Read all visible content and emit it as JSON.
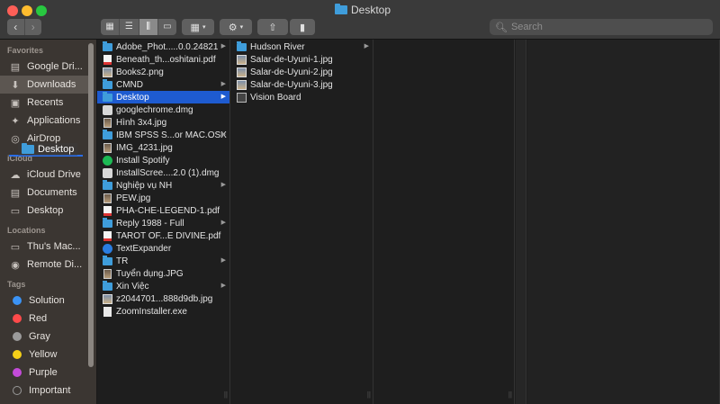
{
  "window": {
    "title": "Desktop"
  },
  "toolbar": {
    "back_icon": "chevron-left-icon",
    "forward_icon": "chevron-right-icon",
    "view_modes": [
      "icon-view",
      "list-view",
      "column-view",
      "gallery-view"
    ],
    "active_view": "column-view",
    "search_placeholder": "Search"
  },
  "sidebar": {
    "sections": [
      {
        "title": "Favorites",
        "items": [
          {
            "label": "Google Dri...",
            "icon": "folder-icon"
          },
          {
            "label": "Downloads",
            "icon": "download-icon",
            "selected": true
          },
          {
            "label": "Recents",
            "icon": "clock-icon"
          },
          {
            "label": "Applications",
            "icon": "applications-icon"
          },
          {
            "label": "AirDrop",
            "icon": "airdrop-icon"
          }
        ]
      },
      {
        "title": "iCloud",
        "items": [
          {
            "label": "iCloud Drive",
            "icon": "cloud-icon"
          },
          {
            "label": "Documents",
            "icon": "document-icon"
          },
          {
            "label": "Desktop",
            "icon": "desktop-icon"
          }
        ]
      },
      {
        "title": "Locations",
        "items": [
          {
            "label": "Thu's Mac...",
            "icon": "laptop-icon"
          },
          {
            "label": "Remote Di...",
            "icon": "disc-icon"
          }
        ]
      },
      {
        "title": "Tags",
        "items": [
          {
            "label": "Solution",
            "color": "#3b93f5"
          },
          {
            "label": "Red",
            "color": "#ff4a4a"
          },
          {
            "label": "Gray",
            "color": "#9b9b9b"
          },
          {
            "label": "Yellow",
            "color": "#f5d018"
          },
          {
            "label": "Purple",
            "color": "#c44bd9"
          },
          {
            "label": "Important",
            "color": ""
          }
        ]
      }
    ],
    "drag_ghost": "Desktop"
  },
  "columns": [
    {
      "items": [
        {
          "name": "Adobe_Phot.....0.0.24821",
          "kind": "folder",
          "has_children": true
        },
        {
          "name": "Beneath_th...oshitani.pdf",
          "kind": "pdf"
        },
        {
          "name": "Books2.png",
          "kind": "image"
        },
        {
          "name": "CMND",
          "kind": "folder",
          "has_children": true
        },
        {
          "name": "Desktop",
          "kind": "folder",
          "has_children": true,
          "selected": true
        },
        {
          "name": "googlechrome.dmg",
          "kind": "dmg"
        },
        {
          "name": "Hình 3x4.jpg",
          "kind": "photo"
        },
        {
          "name": "IBM SPSS S...or MAC.OSX",
          "kind": "folder",
          "has_children": true
        },
        {
          "name": "IMG_4231.jpg",
          "kind": "photo"
        },
        {
          "name": "Install Spotify",
          "kind": "spotify"
        },
        {
          "name": "InstallScree....2.0 (1).dmg",
          "kind": "dmg"
        },
        {
          "name": "Nghiệp vụ NH",
          "kind": "folder",
          "has_children": true
        },
        {
          "name": "PEW.jpg",
          "kind": "photo"
        },
        {
          "name": "PHA-CHE-LEGEND-1.pdf",
          "kind": "pdf"
        },
        {
          "name": "Reply 1988 - Full",
          "kind": "folder",
          "has_children": true
        },
        {
          "name": "TAROT OF...E DIVINE.pdf",
          "kind": "pdf"
        },
        {
          "name": "TextExpander",
          "kind": "app"
        },
        {
          "name": "TR",
          "kind": "folder",
          "has_children": true
        },
        {
          "name": "Tuyển dụng.JPG",
          "kind": "photo"
        },
        {
          "name": "Xin Việc",
          "kind": "folder",
          "has_children": true
        },
        {
          "name": "z2044701...888d9db.jpg",
          "kind": "image"
        },
        {
          "name": "ZoomInstaller.exe",
          "kind": "doc"
        }
      ]
    },
    {
      "items": [
        {
          "name": "Hudson River",
          "kind": "folder",
          "has_children": true
        },
        {
          "name": "Salar-de-Uyuni-1.jpg",
          "kind": "image"
        },
        {
          "name": "Salar-de-Uyuni-2.jpg",
          "kind": "image"
        },
        {
          "name": "Salar-de-Uyuni-3.jpg",
          "kind": "image"
        },
        {
          "name": "Vision Board",
          "kind": "board"
        }
      ]
    }
  ]
}
